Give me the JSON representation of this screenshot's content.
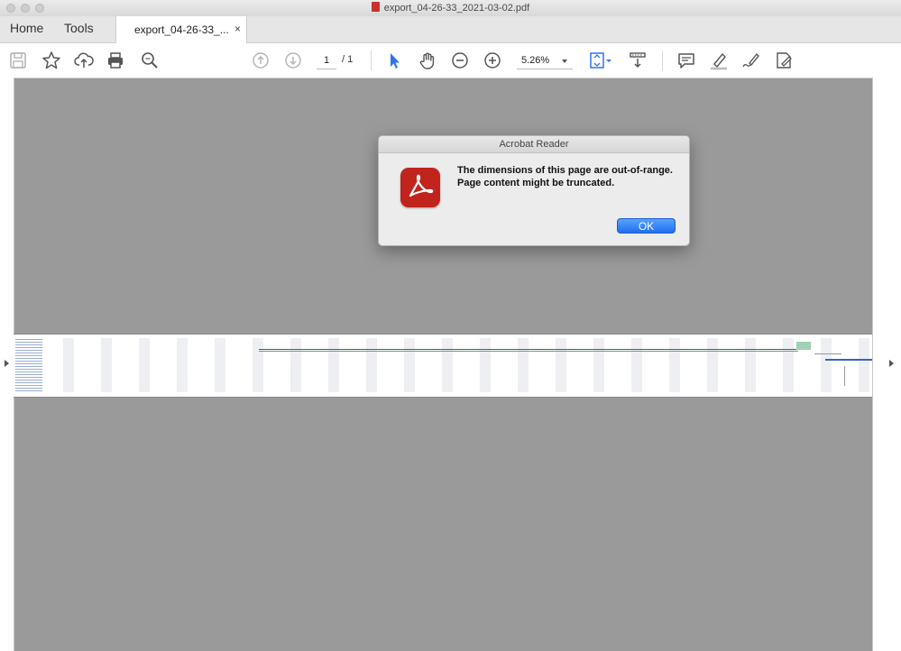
{
  "window": {
    "title": "export_04-26-33_2021-03-02.pdf"
  },
  "tabs": {
    "home": "Home",
    "tools": "Tools",
    "document": "export_04-26-33_...",
    "close": "×"
  },
  "toolbar": {
    "page_current": "1",
    "page_total": "/ 1",
    "zoom": "5.26%"
  },
  "dialog": {
    "title": "Acrobat Reader",
    "message": "The dimensions of this page are out-of-range. Page content might be truncated.",
    "ok_label": "OK"
  },
  "colors": {
    "accent": "#2f73f5",
    "acrobat_red": "#c1241d",
    "viewer_bg": "#9a9a9a"
  }
}
